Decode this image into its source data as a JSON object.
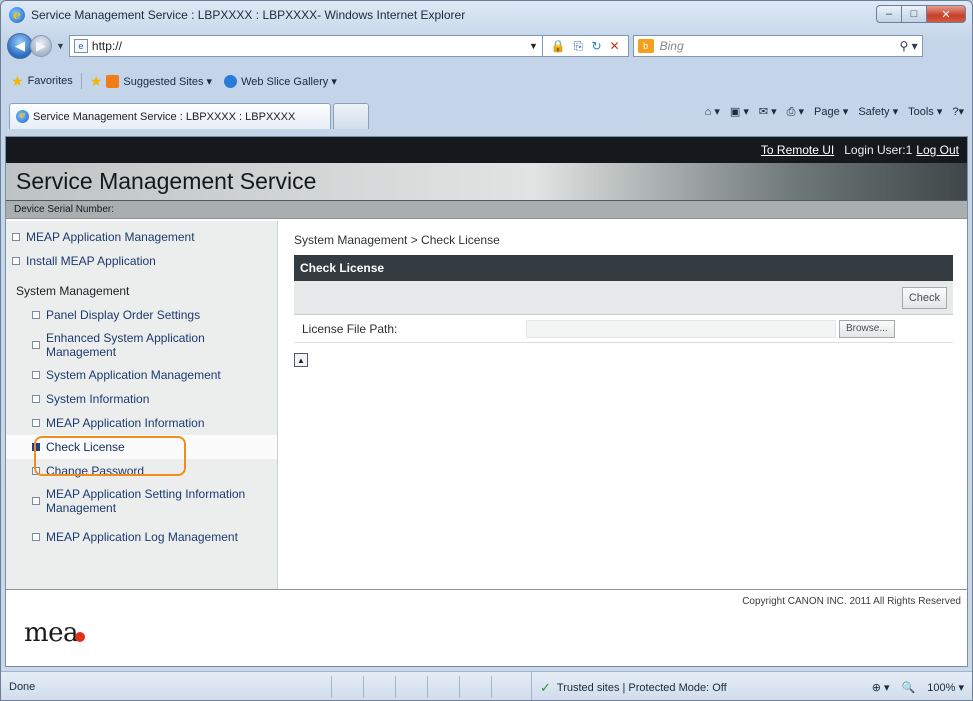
{
  "window": {
    "title": "Service Management Service : LBPXXXX : LBPXXXX- Windows Internet Explorer",
    "minimize": "‒",
    "maximize": "□",
    "close": "✕"
  },
  "addressbar": {
    "url": "http://",
    "search_placeholder": "Bing"
  },
  "favorites": {
    "label": "Favorites",
    "items": [
      "Suggested Sites ▾",
      "Web Slice Gallery ▾"
    ]
  },
  "tabs": [
    {
      "label": "Service Management Service : LBPXXXX : LBPXXXX"
    }
  ],
  "commandbar": {
    "page": "Page ▾",
    "safety": "Safety ▾",
    "tools": "Tools ▾",
    "help": "?▾"
  },
  "topbar": {
    "remote_ui": "To Remote UI",
    "login_user": "Login User:1",
    "logout": "Log Out"
  },
  "banner": {
    "title": "Service Management Service"
  },
  "serial": {
    "label": "Device Serial Number:"
  },
  "sidebar": {
    "top_items": [
      "MEAP Application Management",
      "Install MEAP Application"
    ],
    "header": "System Management",
    "sub_items": [
      "Panel Display Order Settings",
      "Enhanced System Application Management",
      "System Application Management",
      "System Information",
      "MEAP Application Information",
      "Check License",
      "Change Password",
      "MEAP Application Setting Information Management",
      "MEAP Application Log Management"
    ],
    "active": "Check License"
  },
  "content": {
    "breadcrumb": "System Management > Check License",
    "panel_title": "Check License",
    "check_button": "Check",
    "license_label": "License File Path:",
    "license_value": "",
    "browse_button": "Browse..."
  },
  "footer": {
    "copyright": "Copyright CANON INC. 2011 All Rights Reserved",
    "logo": "mea"
  },
  "statusbar": {
    "status": "Done",
    "zone": "Trusted sites | Protected Mode: Off",
    "zoom": "100%"
  },
  "colors": {
    "highlight": "#ef8d1f",
    "panel_header": "#343b41",
    "topbar": "#15191d"
  }
}
